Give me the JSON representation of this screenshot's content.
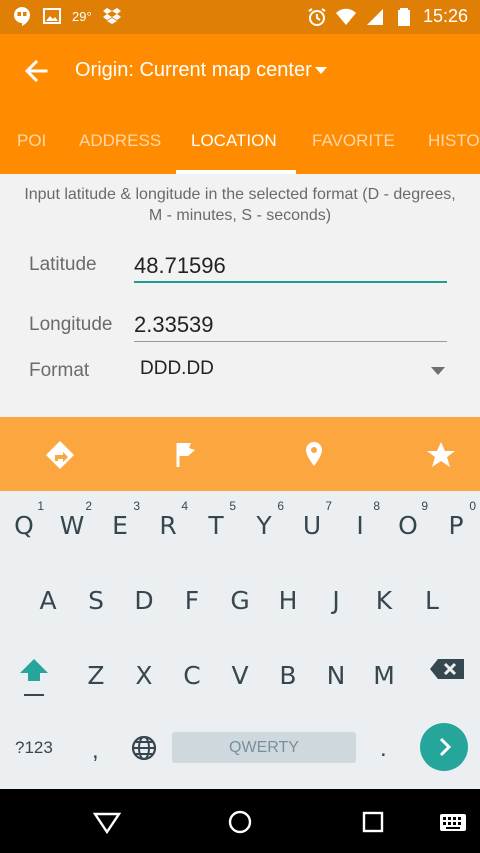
{
  "status_bar": {
    "temperature": "29°",
    "time": "15:26",
    "icons": [
      "hangouts-icon",
      "image-icon",
      "dropbox-icon",
      "alarm-icon",
      "wifi-icon",
      "signal-icon",
      "battery-icon"
    ]
  },
  "toolbar": {
    "title": "Origin: Current map center",
    "back_icon": "arrow-back-icon"
  },
  "tabs": [
    {
      "label": "POI",
      "active": false
    },
    {
      "label": "ADDRESS",
      "active": false
    },
    {
      "label": "LOCATION",
      "active": true
    },
    {
      "label": "FAVORITE",
      "active": false
    },
    {
      "label": "HISTO",
      "active": false
    }
  ],
  "form": {
    "hint": "Input latitude & longitude in the selected format (D - degrees, M - minutes, S - seconds)",
    "latitude": {
      "label": "Latitude",
      "value": "48.71596"
    },
    "longitude": {
      "label": "Longitude",
      "value": "2.33539"
    },
    "format": {
      "label": "Format",
      "value": "DDD.DD"
    }
  },
  "action_bar": {
    "icons": [
      "directions-icon",
      "flag-icon",
      "location-pin-icon",
      "star-icon"
    ]
  },
  "keyboard": {
    "row1": [
      {
        "key": "Q",
        "num": "1"
      },
      {
        "key": "W",
        "num": "2"
      },
      {
        "key": "E",
        "num": "3"
      },
      {
        "key": "R",
        "num": "4"
      },
      {
        "key": "T",
        "num": "5"
      },
      {
        "key": "Y",
        "num": "6"
      },
      {
        "key": "U",
        "num": "7"
      },
      {
        "key": "I",
        "num": "8"
      },
      {
        "key": "O",
        "num": "9"
      },
      {
        "key": "P",
        "num": "0"
      }
    ],
    "row2": [
      "A",
      "S",
      "D",
      "F",
      "G",
      "H",
      "J",
      "K",
      "L"
    ],
    "row3": [
      "Z",
      "X",
      "C",
      "V",
      "B",
      "N",
      "M"
    ],
    "symbols_label": "?123",
    "comma": ",",
    "period": ".",
    "space_label": "QWERTY"
  },
  "colors": {
    "status_bar": "#e07f06",
    "primary": "#ff8c00",
    "action_bar": "#fca640",
    "accent": "#1f9d8f",
    "enter_key": "#26a69a"
  }
}
